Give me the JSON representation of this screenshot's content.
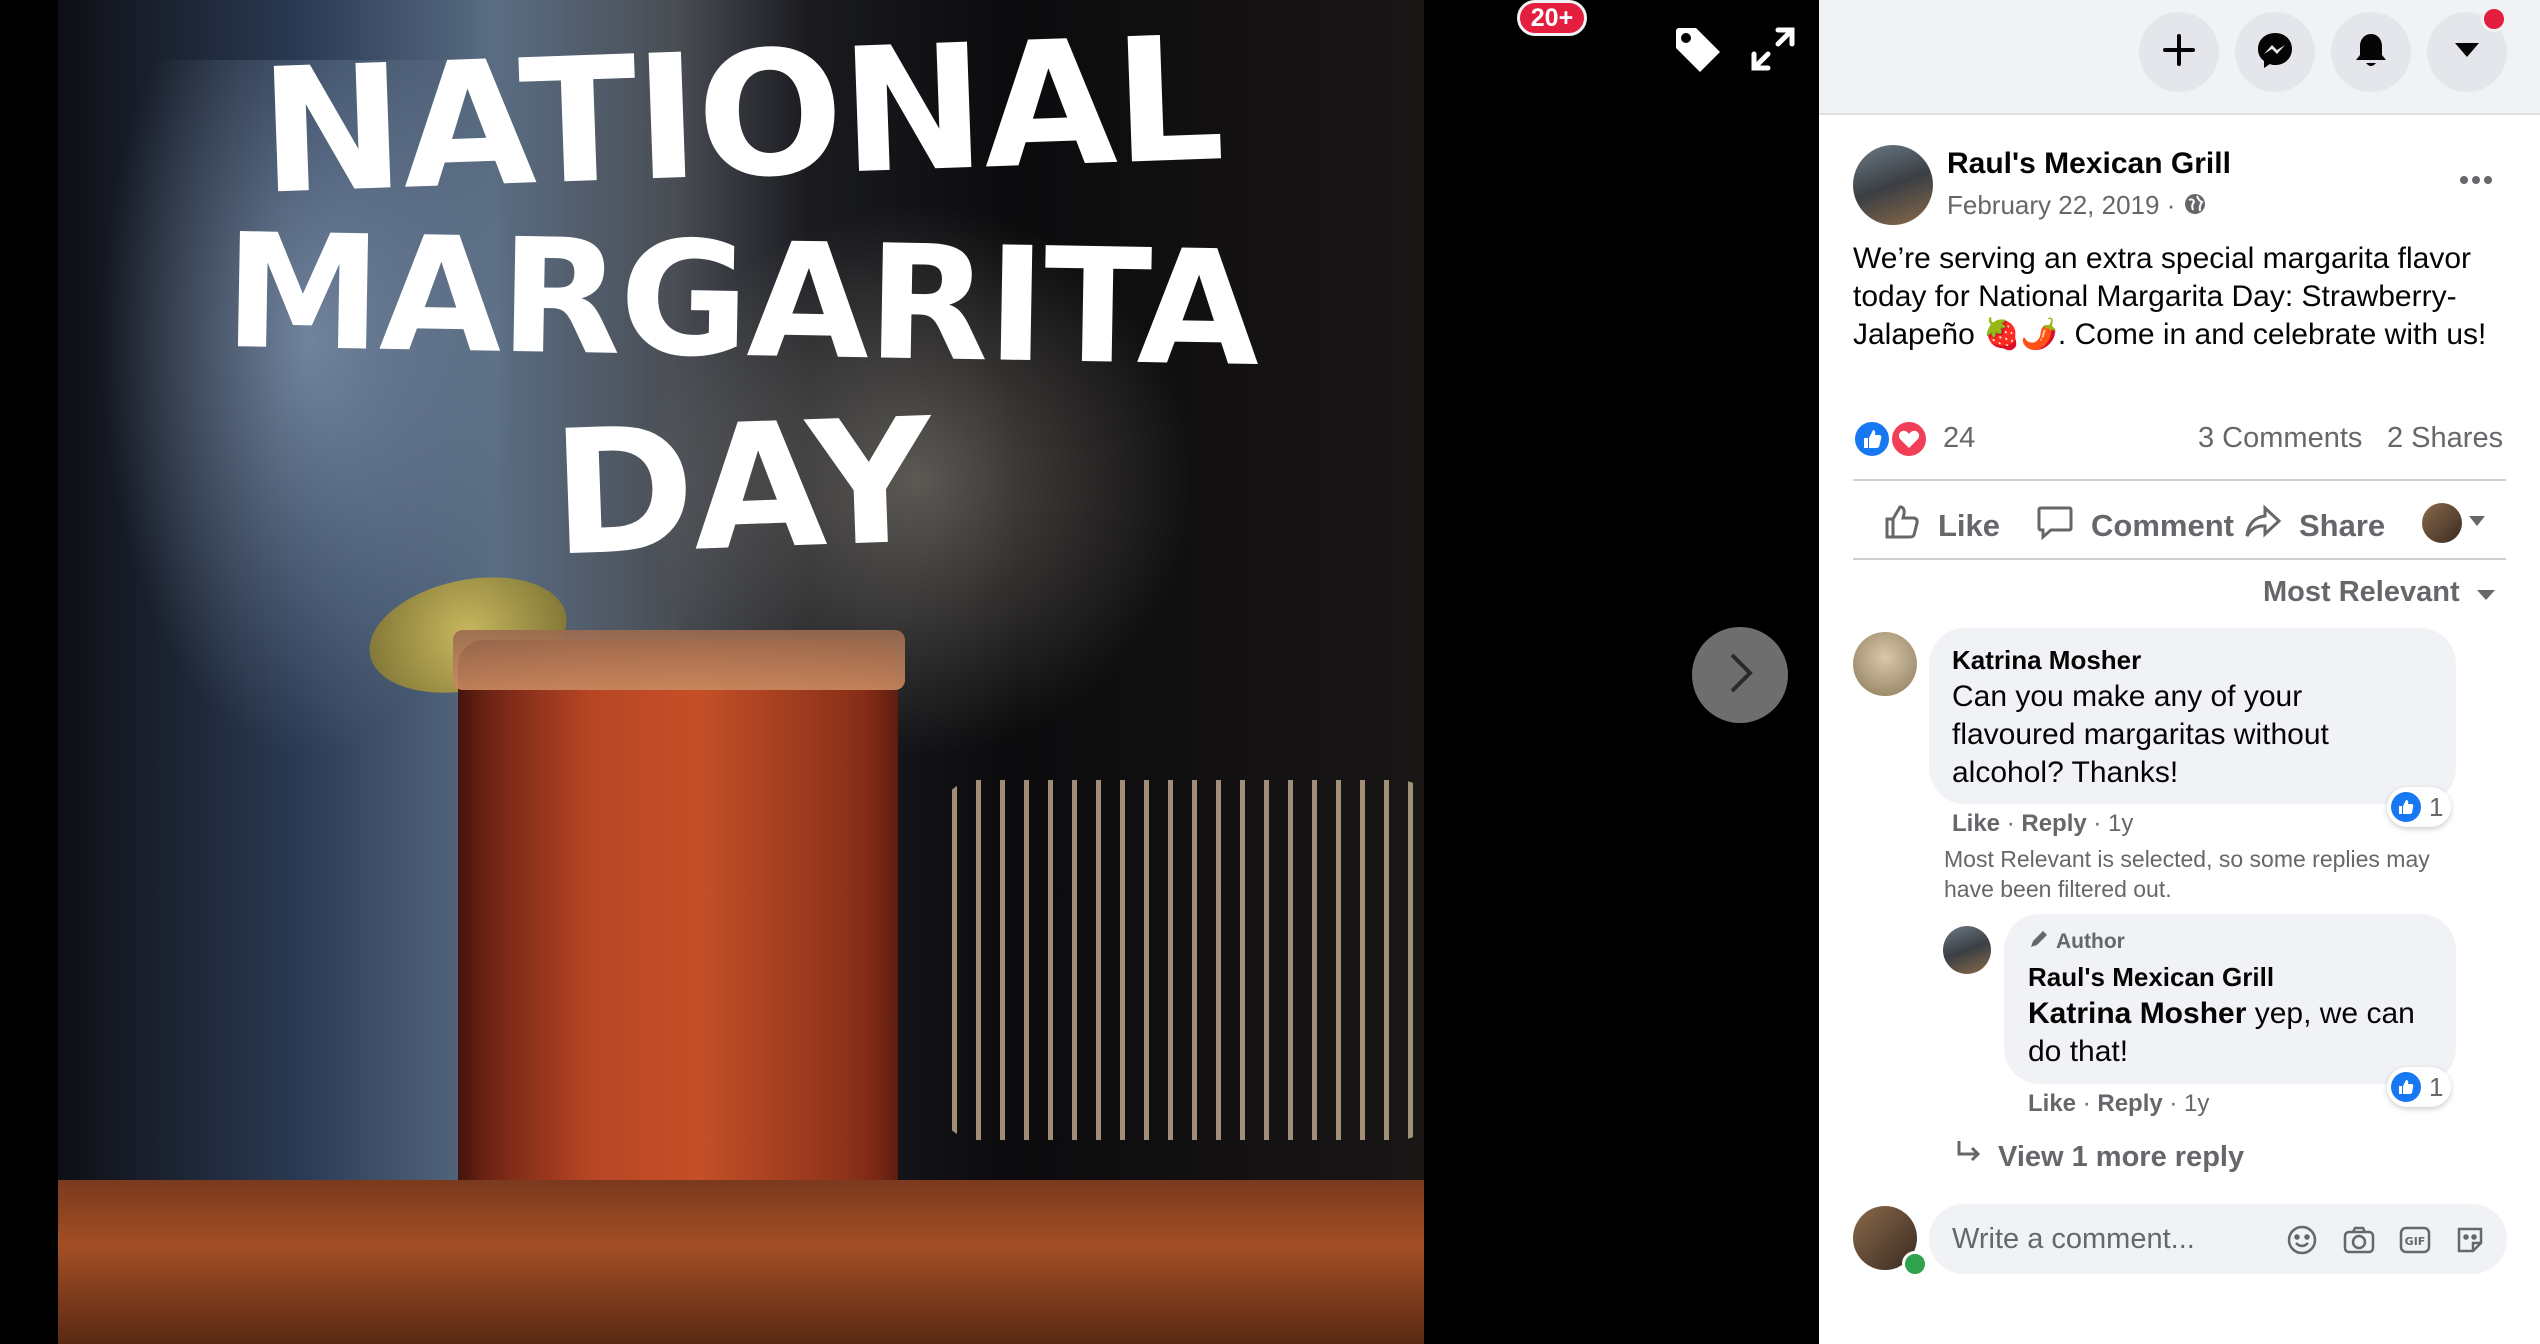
{
  "photo": {
    "overlay_line1": "NATIONAL",
    "overlay_line2": "MARGARITA",
    "overlay_line3": "DAY"
  },
  "viewer_icons": [
    "tag-icon",
    "fullscreen-icon",
    "chevron-right-icon"
  ],
  "topbar": {
    "notifications_badge": "20+",
    "icons": [
      "plus-icon",
      "messenger-icon",
      "bell-icon",
      "caret-down-icon"
    ]
  },
  "post": {
    "page_name": "Raul's Mexican Grill",
    "date": "February 22, 2019 · ",
    "privacy_icon": "globe-icon",
    "text_line1": "We’re serving an extra special margarita flavor",
    "text_line2": "today for National Margarita Day: Strawberry-",
    "text_line3": "Jalapeño 🍓🌶️. Come in and celebrate with us!",
    "reaction_count": "24",
    "comments_count": "3 Comments",
    "shares_count": "2 Shares"
  },
  "actions": {
    "like": "Like",
    "comment": "Comment",
    "share": "Share"
  },
  "comments_filter": "Most Relevant",
  "comments": [
    {
      "author": "Katrina Mosher",
      "line1": "Can you make any of your",
      "line2": "flavoured margaritas without",
      "line3": "alcohol? Thanks!",
      "like": "Like",
      "reply": "Reply",
      "age": " · 1y",
      "reactions": "1"
    }
  ],
  "filter_notice_line1": "Most Relevant is selected, so some replies may",
  "filter_notice_line2": "have been filtered out.",
  "reply": {
    "badge": "Author",
    "author": "Raul's Mexican Grill",
    "mention": "Katrina Mosher",
    "text_rest": " yep, we can",
    "line2": "do that!",
    "like": "Like",
    "reply": "Reply",
    "age": " · 1y",
    "reactions": "1"
  },
  "view_more": "View 1 more reply",
  "composer": {
    "placeholder": "Write a comment...",
    "icons": [
      "emoji-icon",
      "camera-icon",
      "gif-icon",
      "sticker-icon"
    ]
  },
  "colors": {
    "accent": "#1877f2",
    "love": "#f33e58",
    "badge_red": "#e41e3f",
    "online": "#31a24c"
  }
}
